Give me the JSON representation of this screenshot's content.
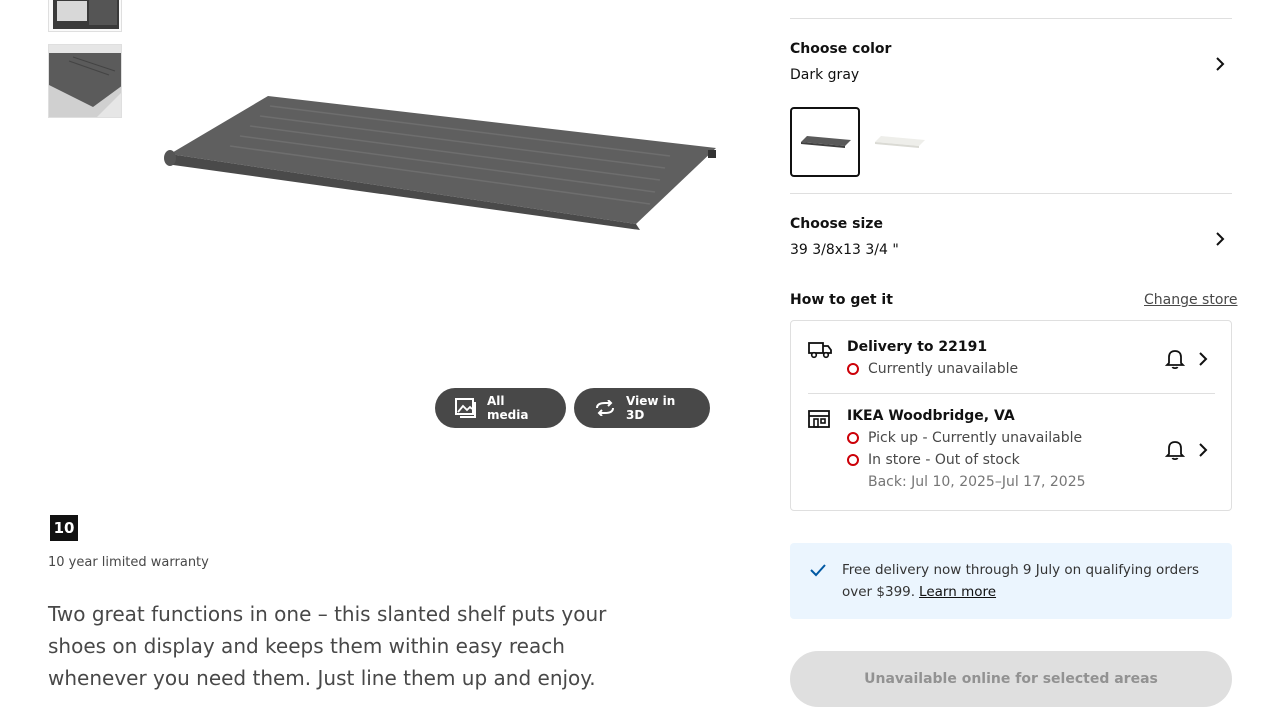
{
  "gallery": {
    "media_buttons": {
      "all_media": "All media",
      "view_3d": "View in 3D"
    }
  },
  "warranty": {
    "badge": "10",
    "text": "10 year limited warranty"
  },
  "description": "Two great functions in one – this slanted shelf puts your shoes on display and keeps them within easy reach whenever you need them. Just line them up and enjoy.",
  "color": {
    "title": "Choose color",
    "value": "Dark gray",
    "swatches": [
      "dark-gray",
      "white"
    ],
    "selected_index": 0
  },
  "size": {
    "title": "Choose size",
    "value": "39 3/8x13 3/4 \""
  },
  "availability": {
    "title": "How to get it",
    "change_store": "Change store",
    "delivery": {
      "title": "Delivery to 22191",
      "status": "Currently unavailable"
    },
    "store": {
      "title": "IKEA Woodbridge, VA",
      "pickup": "Pick up - Currently unavailable",
      "in_store": "In store - Out of stock",
      "back": "Back: Jul 10, 2025–Jul 17, 2025"
    }
  },
  "promo": {
    "text": "Free delivery now through 9 July on qualifying orders over $399.",
    "link": "Learn more"
  },
  "cta": {
    "label": "Unavailable online for selected areas"
  },
  "colors": {
    "status_red": "#cc0008",
    "promo_bg": "#ebf5fe",
    "check_blue": "#0058a3",
    "button_dark": "#484848"
  }
}
